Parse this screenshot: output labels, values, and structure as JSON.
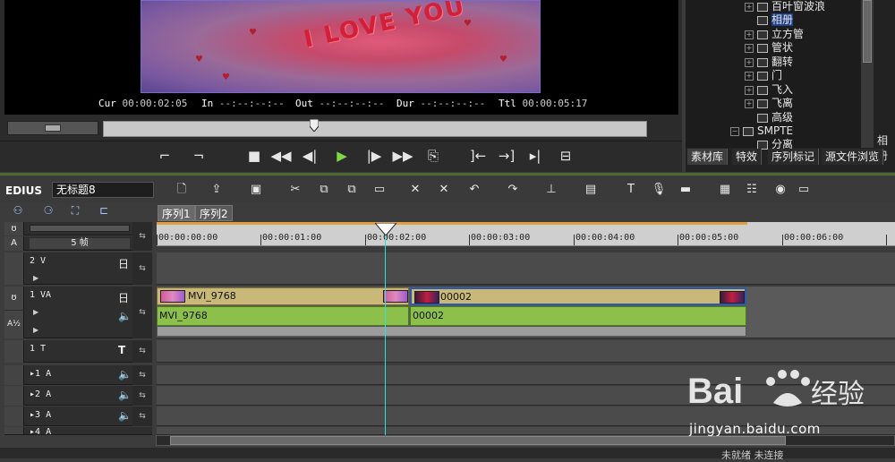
{
  "preview": {
    "video_text": "I LOVE YOU",
    "timecodes": [
      {
        "label": "Cur",
        "value": "00:00:02:05"
      },
      {
        "label": "In",
        "value": "--:--:--:--"
      },
      {
        "label": "Out",
        "value": "--:--:--:--"
      },
      {
        "label": "Dur",
        "value": "--:--:--:--"
      },
      {
        "label": "Ttl",
        "value": "00:00:05:17"
      }
    ]
  },
  "bin": {
    "tree": [
      {
        "label": "百叶窗波浪",
        "expandable": true,
        "selected": false
      },
      {
        "label": "相册",
        "expandable": false,
        "selected": true
      },
      {
        "label": "立方管",
        "expandable": true,
        "selected": false
      },
      {
        "label": "管状",
        "expandable": true,
        "selected": false
      },
      {
        "label": "翻转",
        "expandable": true,
        "selected": false
      },
      {
        "label": "门",
        "expandable": true,
        "selected": false
      },
      {
        "label": "飞入",
        "expandable": true,
        "selected": false
      },
      {
        "label": "飞离",
        "expandable": true,
        "selected": false
      },
      {
        "label": "高级",
        "expandable": false,
        "selected": false
      },
      {
        "label": "SMPTE",
        "expandable": true,
        "selected": false
      },
      {
        "label": "分离",
        "expandable": false,
        "selected": false
      }
    ],
    "side_label": "相册",
    "tabs": [
      "素材库",
      "特效",
      "序列标记",
      "源文件浏览"
    ]
  },
  "timeline": {
    "app_name": "EDIUS",
    "sequence_title": "无标题8",
    "tabs": [
      "序列1",
      "序列2"
    ],
    "zoom": "5 帧",
    "ruler": [
      "00:00:00:00",
      "00:00:01:00",
      "00:00:02:00",
      "00:00:03:00",
      "00:00:04:00",
      "00:00:05:00",
      "00:00:06:00"
    ],
    "tracks": {
      "v2": "2 V",
      "va1": "1 VA",
      "t1": "1 T",
      "a1": "1 A",
      "a2": "2 A",
      "a3": "3 A",
      "a4": "4 A"
    },
    "clips": {
      "clip1_name": "MVI_9768",
      "clip1_audio": "MVI_9768",
      "clip2_name": "00002",
      "clip2_audio": "00002"
    }
  },
  "watermark": {
    "brand": "Bai 经验",
    "url": "jingyan.baidu.com"
  },
  "status": {
    "text": "未就绪        未连接"
  }
}
